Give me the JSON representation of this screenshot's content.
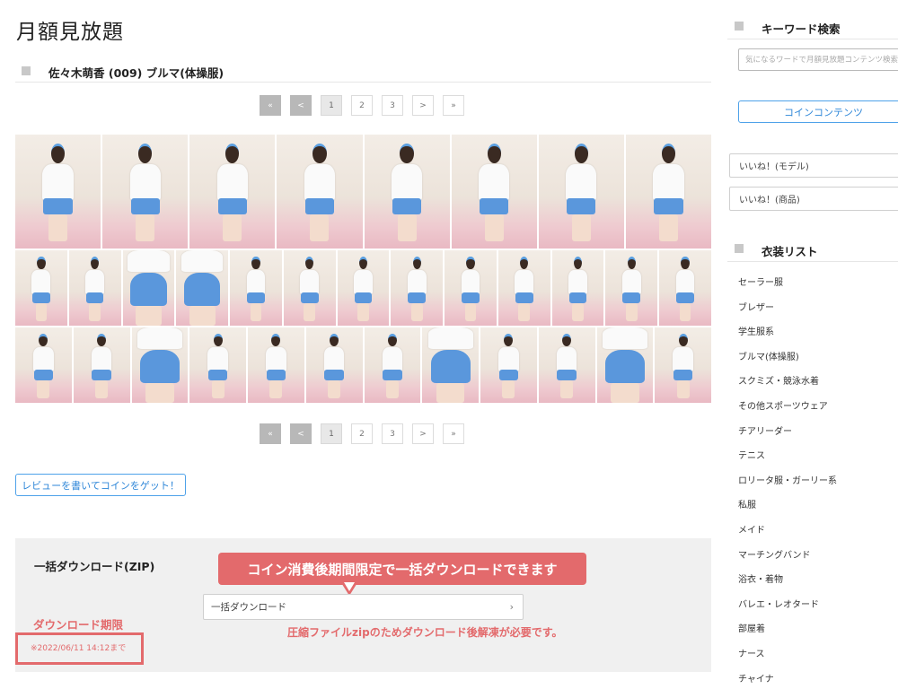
{
  "page": {
    "title": "月額見放題"
  },
  "gallery": {
    "title": "佐々木萌香 (009) ブルマ(体操服)",
    "pager": {
      "first": "«",
      "prev": "<",
      "pages": [
        "1",
        "2",
        "3"
      ],
      "next": ">",
      "last": "»"
    },
    "rows": [
      8,
      13,
      12
    ]
  },
  "review_button": "レビューを書いてコインをゲット！",
  "download": {
    "title": "一括ダウンロード(ZIP)",
    "callout": "コイン消費後期間限定で一括ダウンロードできます",
    "select_label": "一括ダウンロード",
    "note": "圧縮ファイルzipのためダウンロード後解凍が必要です。",
    "limit_label": "ダウンロード期限",
    "limit_date": "※2022/06/11 14:12まで"
  },
  "sidebar": {
    "keyword_title": "キーワード検索",
    "keyword_placeholder": "気になるワードで月額見放題コンテンツ検索",
    "coin_button": "コインコンテンツ",
    "likes": [
      "いいね！(モデル)",
      "いいね！(商品)"
    ],
    "costume_title": "衣装リスト",
    "costumes": [
      "セーラー服",
      "ブレザー",
      "学生服系",
      "ブルマ(体操服)",
      "スクミズ・競泳水着",
      "その他スポーツウェア",
      "チアリーダー",
      "テニス",
      "ロリータ服・ガーリー系",
      "私服",
      "メイド",
      "マーチングバンド",
      "浴衣・着物",
      "バレエ・レオタード",
      "部屋着",
      "ナース",
      "チャイナ"
    ]
  },
  "colors": {
    "accent_red": "#e36a6c",
    "accent_blue": "#4ea2e9",
    "bloomers_blue": "#5a97dc"
  }
}
